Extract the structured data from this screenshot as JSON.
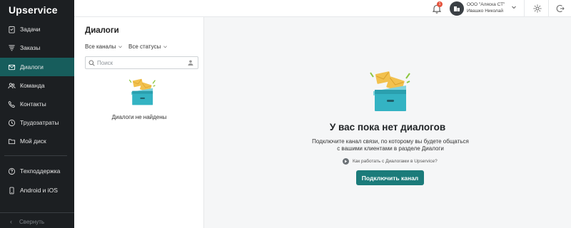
{
  "app": {
    "logo_text": "Upservice"
  },
  "sidebar": {
    "items": [
      {
        "label": "Задачи",
        "icon": "tasks-icon"
      },
      {
        "label": "Заказы",
        "icon": "orders-funnel-icon"
      },
      {
        "label": "Диалоги",
        "icon": "mail-icon",
        "active": true
      },
      {
        "label": "Команда",
        "icon": "team-icon"
      },
      {
        "label": "Контакты",
        "icon": "phone-icon"
      },
      {
        "label": "Трудозатраты",
        "icon": "clock-icon"
      },
      {
        "label": "Мой диск",
        "icon": "folder-icon"
      }
    ],
    "support_items": [
      {
        "label": "Техподдержка",
        "icon": "help-circle-icon"
      },
      {
        "label": "Android и iOS",
        "icon": "mobile-icon"
      }
    ],
    "collapse_label": "Свернуть"
  },
  "topbar": {
    "notifications_count": "1",
    "org_name": "ООО \"Аляска СТ\"",
    "user_name": "Ивашко Николай"
  },
  "dialogs_panel": {
    "title": "Диалоги",
    "channel_filter": "Все каналы",
    "status_filter": "Все статусы",
    "search_placeholder": "Поиск",
    "empty_text": "Диалоги не найдены"
  },
  "main": {
    "title": "У вас пока нет диалогов",
    "description_line1": "Подключите канал связи, по которому вы будете общаться",
    "description_line2": "с вашими клиентами в разделе Диалоги",
    "help_link": "Как работать с Диалогами в Upservice?",
    "cta_label": "Подключить канал"
  },
  "colors": {
    "sidebar_bg": "#1c1f22",
    "active_item": "#175d5c",
    "accent": "#1b7b7a",
    "badge": "#e5533d",
    "illustration_box": "#34b3c3",
    "illustration_envelope": "#f2c14e"
  }
}
